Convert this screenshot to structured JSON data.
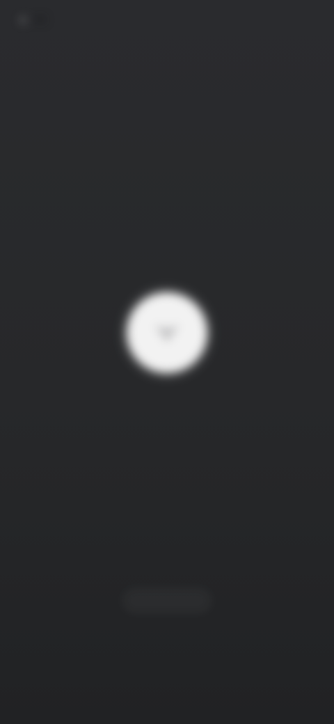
{
  "top_bar": {
    "back_icon": "chevron-left-icon",
    "back_label": "",
    "action_label": ""
  },
  "center": {
    "logo_icon": "brand-logo-icon",
    "message": ""
  },
  "bottom": {
    "button_label": ""
  },
  "colors": {
    "background": "#262729",
    "logo_circle": "#f2f2f2",
    "text": "#c8c9cb"
  }
}
